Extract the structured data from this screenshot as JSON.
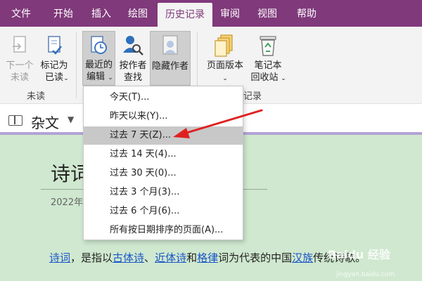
{
  "tabs": [
    "文件",
    "开始",
    "插入",
    "绘图",
    "历史记录",
    "审阅",
    "视图",
    "帮助"
  ],
  "ribbon": {
    "next_unread": [
      "下一个",
      "未读"
    ],
    "mark_read": [
      "标记为",
      "已读"
    ],
    "unread_group": "未读",
    "recent_edits": [
      "最近的",
      "编辑"
    ],
    "find_by_author": [
      "按作者",
      "查找"
    ],
    "hide_authors": "隐藏作者",
    "page_versions": "页面版本",
    "notebook_recycle": [
      "笔记本",
      "回收站"
    ],
    "history_group_fragment": "记录"
  },
  "section": {
    "name": "杂文"
  },
  "page": {
    "title": "诗词",
    "date": "2022年",
    "body": {
      "link1": "诗词",
      "t1": "，是指以",
      "link2": "古体诗",
      "t2": "、",
      "link3": "近体诗",
      "t3": "和",
      "link4": "格律",
      "t4": "词为代表的中国",
      "link5": "汉族",
      "t5": "传统诗歌。"
    }
  },
  "menu": {
    "items": [
      "今天(T)...",
      "昨天以来(Y)...",
      "过去 7 天(Z)...",
      "过去 14 天(4)...",
      "过去 30 天(0)...",
      "过去 3 个月(3)...",
      "过去 6 个月(6)...",
      "所有按日期排序的页面(A)..."
    ],
    "highlighted_index": 2
  },
  "watermark": {
    "main": "Baidu 经验",
    "sub": "jingyan.baidu.com"
  },
  "colors": {
    "brand": "#80397b",
    "content_bg": "#cfe8cf",
    "highlight": "#c8c8c8",
    "arrow": "#e02020",
    "link": "#1a55c8"
  }
}
